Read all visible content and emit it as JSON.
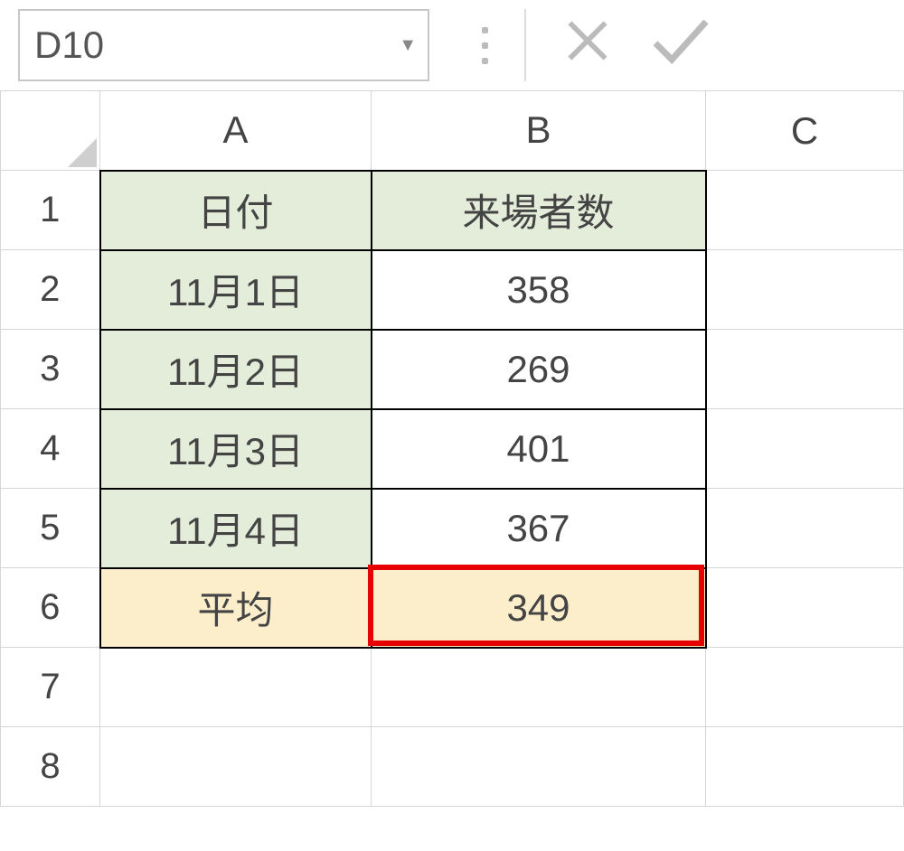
{
  "formula_bar": {
    "name_box_value": "D10"
  },
  "columns": {
    "A": "A",
    "B": "B",
    "C": "C"
  },
  "rows": {
    "1": "1",
    "2": "2",
    "3": "3",
    "4": "4",
    "5": "5",
    "6": "6",
    "7": "7",
    "8": "8"
  },
  "cells": {
    "A1": "日付",
    "B1": "来場者数",
    "A2": "11月1日",
    "B2": "358",
    "A3": "11月2日",
    "B3": "269",
    "A4": "11月3日",
    "B4": "401",
    "A5": "11月4日",
    "B5": "367",
    "A6": "平均",
    "B6": "349"
  },
  "highlight": {
    "cell": "B6"
  }
}
